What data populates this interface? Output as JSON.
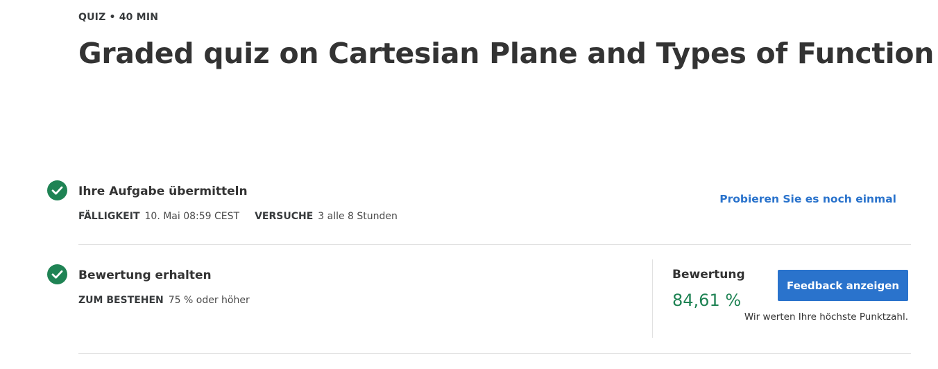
{
  "header": {
    "meta": "QUIZ • 40 MIN",
    "title": "Graded quiz on Cartesian Plane and Types of Function"
  },
  "steps": [
    {
      "heading": "Ihre Aufgabe übermitteln",
      "details": [
        {
          "label": "FÄLLIGKEIT",
          "value": "10. Mai 08:59 CEST"
        },
        {
          "label": "VERSUCHE",
          "value": "3 alle 8 Stunden"
        }
      ],
      "action_label": "Probieren Sie es noch einmal"
    },
    {
      "heading": "Bewertung erhalten",
      "details": [
        {
          "label": "ZUM BESTEHEN",
          "value": "75 % oder höher"
        }
      ]
    }
  ],
  "grade": {
    "label": "Bewertung",
    "value": "84,61 %",
    "button_label": "Feedback anzeigen",
    "note": "Wir werten Ihre höchste Punktzahl."
  },
  "colors": {
    "success": "#1f8354",
    "accent": "#2a73cc"
  },
  "icons": {
    "step_complete": "checkmark-circle-icon"
  }
}
